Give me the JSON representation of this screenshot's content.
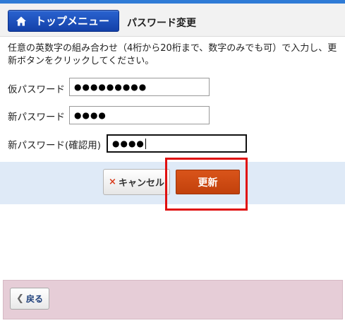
{
  "header": {
    "top_menu_label": "トップメニュー",
    "page_title": "パスワード変更"
  },
  "description": "任意の英数字の組み合わせ（4桁から20桁まで、数字のみでも可）で入力し、更新ボタンをクリックしてください。",
  "form": {
    "temp_password": {
      "label": "仮パスワード",
      "masked_value": "●●●●●●●●●"
    },
    "new_password": {
      "label": "新パスワード",
      "masked_value": "●●●●"
    },
    "confirm_password": {
      "label": "新パスワード(確認用)",
      "masked_value": "●●●●"
    }
  },
  "actions": {
    "cancel_label": "キャンセル",
    "cancel_icon": "×",
    "update_label": "更新"
  },
  "footer": {
    "back_label": "戻る",
    "back_icon": "❮"
  },
  "colors": {
    "top_menu_blue": "#1a4fbf",
    "update_orange": "#c8480f",
    "highlight_red": "#e01010",
    "action_band": "#dfeaf7",
    "footer_pink": "#e6cdd7"
  }
}
